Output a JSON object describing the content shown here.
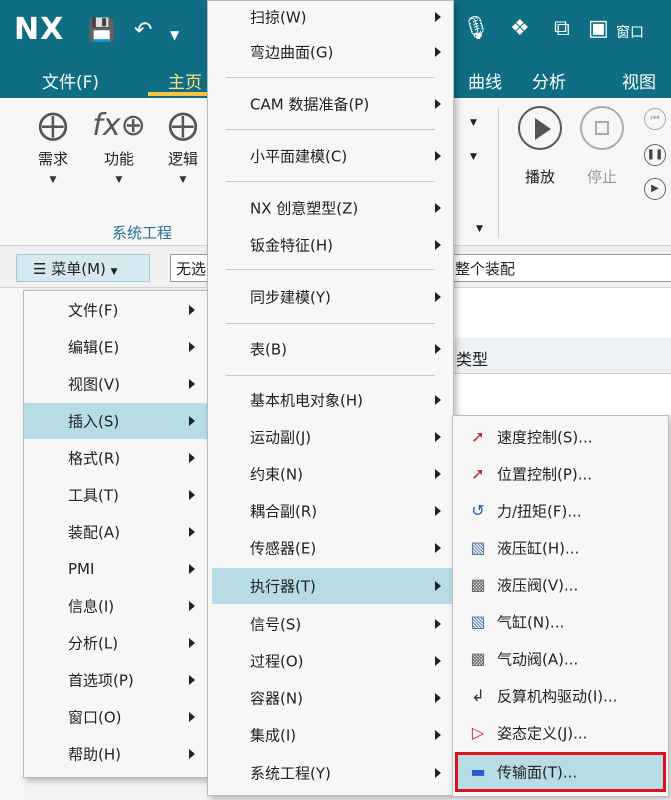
{
  "app": {
    "logo": "NX",
    "window_label": "窗口"
  },
  "tabs": [
    {
      "label": "文件(F)"
    },
    {
      "label": "主页"
    },
    {
      "label": "曲线"
    },
    {
      "label": "分析"
    },
    {
      "label": "视图"
    }
  ],
  "ribbon": {
    "buttons": [
      {
        "label": "需求"
      },
      {
        "label": "功能"
      },
      {
        "label": "逻辑"
      }
    ],
    "group_label": "系统工程",
    "play_label": "播放",
    "stop_label": "停止"
  },
  "cmdbar": {
    "menu_label": "菜单(M)",
    "selection_filter": "无选",
    "scope": "整个装配"
  },
  "panel": {
    "type_header": "类型"
  },
  "main_menu": {
    "items": [
      {
        "label": "文件(F)"
      },
      {
        "label": "编辑(E)"
      },
      {
        "label": "视图(V)"
      },
      {
        "label": "插入(S)"
      },
      {
        "label": "格式(R)"
      },
      {
        "label": "工具(T)"
      },
      {
        "label": "装配(A)"
      },
      {
        "label": "PMI"
      },
      {
        "label": "信息(I)"
      },
      {
        "label": "分析(L)"
      },
      {
        "label": "首选项(P)"
      },
      {
        "label": "窗口(O)"
      },
      {
        "label": "帮助(H)"
      }
    ]
  },
  "insert_menu": {
    "items": [
      {
        "label": "扫掠(W)"
      },
      {
        "label": "弯边曲面(G)"
      },
      {
        "label": "CAM 数据准备(P)"
      },
      {
        "label": "小平面建模(C)"
      },
      {
        "label": "NX 创意塑型(Z)"
      },
      {
        "label": "钣金特征(H)"
      },
      {
        "label": "同步建模(Y)"
      },
      {
        "label": "表(B)"
      },
      {
        "label": "基本机电对象(H)"
      },
      {
        "label": "运动副(J)"
      },
      {
        "label": "约束(N)"
      },
      {
        "label": "耦合副(R)"
      },
      {
        "label": "传感器(E)"
      },
      {
        "label": "执行器(T)"
      },
      {
        "label": "信号(S)"
      },
      {
        "label": "过程(O)"
      },
      {
        "label": "容器(N)"
      },
      {
        "label": "集成(I)"
      },
      {
        "label": "系统工程(Y)"
      }
    ]
  },
  "actuator_menu": {
    "items": [
      {
        "label": "速度控制(S)...",
        "icon": "speed-control-icon"
      },
      {
        "label": "位置控制(P)...",
        "icon": "position-control-icon"
      },
      {
        "label": "力/扭矩(F)...",
        "icon": "force-torque-icon"
      },
      {
        "label": "液压缸(H)...",
        "icon": "hydraulic-cylinder-icon"
      },
      {
        "label": "液压阀(V)...",
        "icon": "hydraulic-valve-icon"
      },
      {
        "label": "气缸(N)...",
        "icon": "pneumatic-cylinder-icon"
      },
      {
        "label": "气动阀(A)...",
        "icon": "pneumatic-valve-icon"
      },
      {
        "label": "反算机构驱动(I)...",
        "icon": "inverse-kinematics-icon"
      },
      {
        "label": "姿态定义(J)...",
        "icon": "pose-definition-icon"
      },
      {
        "label": "传输面(T)...",
        "icon": "transport-surface-icon"
      }
    ]
  },
  "colors": {
    "title_bar": "#0f6e84",
    "highlight": "#b7dce6",
    "callout": "#d9121c"
  }
}
